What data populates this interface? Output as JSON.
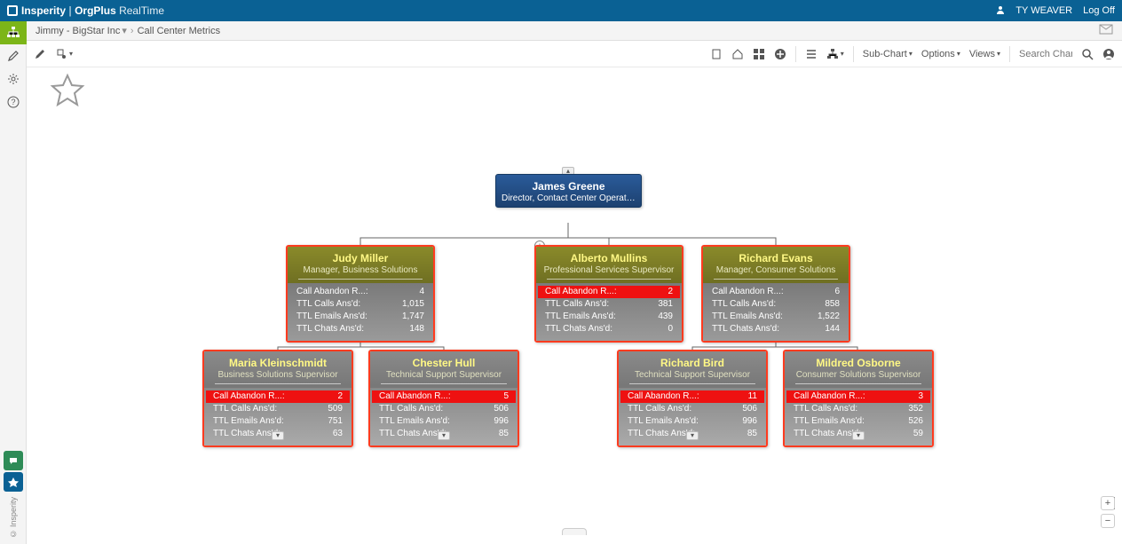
{
  "app": {
    "brand1": "Insperity",
    "brand2": "OrgPlus",
    "brand3": "RealTime"
  },
  "header": {
    "user": "TY WEAVER",
    "logoff": "Log Off"
  },
  "breadcrumb": {
    "a": "Jimmy - BigStar Inc",
    "b": "Call Center Metrics"
  },
  "toolbar": {
    "subchart": "Sub-Chart",
    "options": "Options",
    "views": "Views",
    "search_placeholder": "Search Chart..."
  },
  "sidebar_footer": {
    "copyright": "© Insperity"
  },
  "metric_labels": {
    "abandon": "Call Abandon R...:",
    "calls": "TTL Calls Ans'd:",
    "emails": "TTL Emails Ans'd:",
    "chats": "TTL Chats Ans'd:"
  },
  "nodes": {
    "root": {
      "name": "James Greene",
      "title": "Director, Contact Center Operations"
    },
    "judy": {
      "name": "Judy Miller",
      "title": "Manager, Business Solutions",
      "abandon": "4",
      "calls": "1,015",
      "emails": "1,747",
      "chats": "148",
      "abandon_alert": false
    },
    "alberto": {
      "name": "Alberto Mullins",
      "title": "Professional Services Supervisor",
      "abandon": "2",
      "calls": "381",
      "emails": "439",
      "chats": "0",
      "abandon_alert": true
    },
    "richard": {
      "name": "Richard Evans",
      "title": "Manager, Consumer Solutions",
      "abandon": "6",
      "calls": "858",
      "emails": "1,522",
      "chats": "144",
      "abandon_alert": false
    },
    "maria": {
      "name": "Maria Kleinschmidt",
      "title": "Business Solutions Supervisor",
      "abandon": "2",
      "calls": "509",
      "emails": "751",
      "chats": "63",
      "abandon_alert": true
    },
    "chester": {
      "name": "Chester Hull",
      "title": "Technical Support Supervisor",
      "abandon": "5",
      "calls": "506",
      "emails": "996",
      "chats": "85",
      "abandon_alert": true
    },
    "rbird": {
      "name": "Richard Bird",
      "title": "Technical Support Supervisor",
      "abandon": "11",
      "calls": "506",
      "emails": "996",
      "chats": "85",
      "abandon_alert": true
    },
    "mildred": {
      "name": "Mildred Osborne",
      "title": "Consumer Solutions Supervisor",
      "abandon": "3",
      "calls": "352",
      "emails": "526",
      "chats": "59",
      "abandon_alert": true
    }
  },
  "chart_data": {
    "type": "tree",
    "title": "Call Center Metrics",
    "root": {
      "name": "James Greene",
      "title": "Director, Contact Center Operations",
      "children": [
        {
          "name": "Judy Miller",
          "title": "Manager, Business Solutions",
          "metrics": {
            "Call Abandon R...": 4,
            "TTL Calls Ans'd": 1015,
            "TTL Emails Ans'd": 1747,
            "TTL Chats Ans'd": 148
          },
          "children": [
            {
              "name": "Maria Kleinschmidt",
              "title": "Business Solutions Supervisor",
              "metrics": {
                "Call Abandon R...": 2,
                "TTL Calls Ans'd": 509,
                "TTL Emails Ans'd": 751,
                "TTL Chats Ans'd": 63
              }
            },
            {
              "name": "Chester Hull",
              "title": "Technical Support Supervisor",
              "metrics": {
                "Call Abandon R...": 5,
                "TTL Calls Ans'd": 506,
                "TTL Emails Ans'd": 996,
                "TTL Chats Ans'd": 85
              }
            }
          ]
        },
        {
          "name": "Alberto Mullins",
          "title": "Professional Services Supervisor",
          "metrics": {
            "Call Abandon R...": 2,
            "TTL Calls Ans'd": 381,
            "TTL Emails Ans'd": 439,
            "TTL Chats Ans'd": 0
          }
        },
        {
          "name": "Richard Evans",
          "title": "Manager, Consumer Solutions",
          "metrics": {
            "Call Abandon R...": 6,
            "TTL Calls Ans'd": 858,
            "TTL Emails Ans'd": 1522,
            "TTL Chats Ans'd": 144
          },
          "children": [
            {
              "name": "Richard Bird",
              "title": "Technical Support Supervisor",
              "metrics": {
                "Call Abandon R...": 11,
                "TTL Calls Ans'd": 506,
                "TTL Emails Ans'd": 996,
                "TTL Chats Ans'd": 85
              }
            },
            {
              "name": "Mildred Osborne",
              "title": "Consumer Solutions Supervisor",
              "metrics": {
                "Call Abandon R...": 3,
                "TTL Calls Ans'd": 352,
                "TTL Emails Ans'd": 526,
                "TTL Chats Ans'd": 59
              }
            }
          ]
        }
      ]
    }
  }
}
